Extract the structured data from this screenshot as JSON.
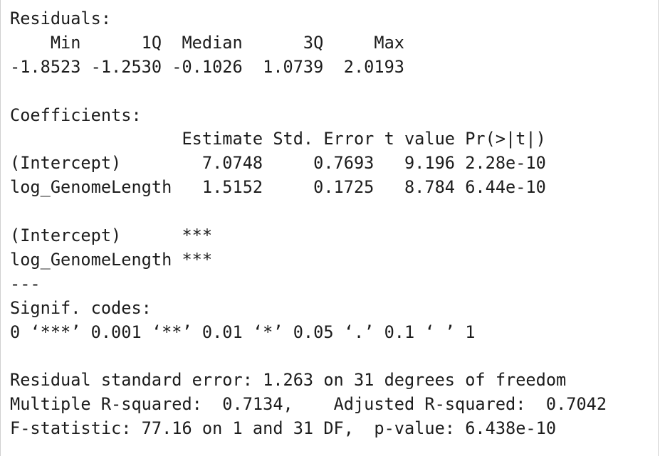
{
  "console": {
    "lines": [
      "Residuals:",
      "    Min      1Q  Median      3Q     Max ",
      "-1.8523 -1.2530 -0.1026  1.0739  2.0193 ",
      "",
      "Coefficients:",
      "                 Estimate Std. Error t value Pr(>|t|)",
      "(Intercept)        7.0748     0.7693   9.196 2.28e-10",
      "log_GenomeLength   1.5152     0.1725   8.784 6.44e-10",
      "",
      "(Intercept)      ***",
      "log_GenomeLength ***",
      "---",
      "Signif. codes:",
      "0 ‘***’ 0.001 ‘**’ 0.01 ‘*’ 0.05 ‘.’ 0.1 ‘ ’ 1",
      "",
      "Residual standard error: 1.263 on 31 degrees of freedom",
      "Multiple R-squared:  0.7134,\tAdjusted R-squared:  0.7042 ",
      "F-statistic: 77.16 on 1 and 31 DF,  p-value: 6.438e-10"
    ]
  }
}
